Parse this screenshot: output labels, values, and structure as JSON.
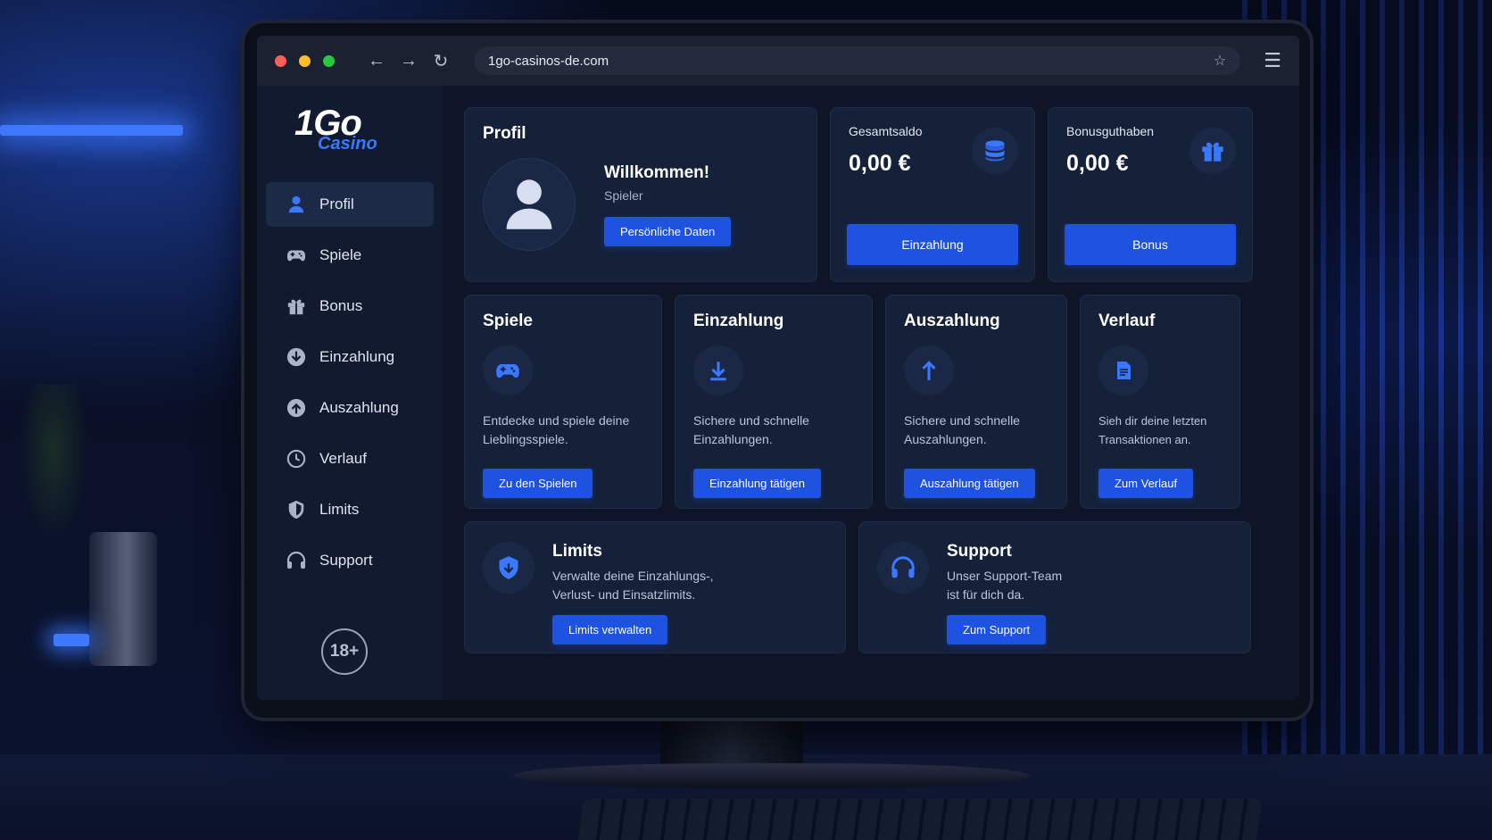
{
  "browser": {
    "url": "1go-casinos-de.com"
  },
  "brand": {
    "name": "1Go",
    "sub": "Casino",
    "accent": "#1d53e0"
  },
  "sidebar": {
    "items": [
      {
        "label": "Profil",
        "icon": "user-icon"
      },
      {
        "label": "Spiele",
        "icon": "gamepad-icon"
      },
      {
        "label": "Bonus",
        "icon": "gift-icon"
      },
      {
        "label": "Einzahlung",
        "icon": "arrow-down-circle-icon"
      },
      {
        "label": "Auszahlung",
        "icon": "arrow-up-circle-icon"
      },
      {
        "label": "Verlauf",
        "icon": "clock-icon"
      },
      {
        "label": "Limits",
        "icon": "shield-icon"
      },
      {
        "label": "Support",
        "icon": "headset-icon"
      }
    ],
    "age_badge": "18+"
  },
  "profile": {
    "title": "Profil",
    "welcome": "Willkommen!",
    "role": "Spieler",
    "button": "Persönliche Daten"
  },
  "balance": {
    "label": "Gesamtsaldo",
    "value": "0,00 €",
    "button": "Einzahlung"
  },
  "bonus": {
    "label": "Bonusguthaben",
    "value": "0,00 €",
    "button": "Bonus"
  },
  "features": [
    {
      "title": "Spiele",
      "desc": "Entdecke und spiele deine Lieblingsspiele.",
      "button": "Zu den Spielen"
    },
    {
      "title": "Einzahlung",
      "desc": "Sichere und schnelle Einzahlungen.",
      "button": "Einzahlung tätigen"
    },
    {
      "title": "Auszahlung",
      "desc": "Sichere und schnelle Auszahlungen.",
      "button": "Auszahlung tätigen"
    },
    {
      "title": "Verlauf",
      "desc": "Sieh dir deine letzten Transaktionen an.",
      "button": "Zum Verlauf"
    }
  ],
  "limits": {
    "title": "Limits",
    "desc": "Verwalte deine Einzahlungs-, Verlust- und Einsatzlimits.",
    "button": "Limits verwalten"
  },
  "support": {
    "title": "Support",
    "desc": "Unser Support-Team ist für dich da.",
    "button": "Zum Support"
  }
}
